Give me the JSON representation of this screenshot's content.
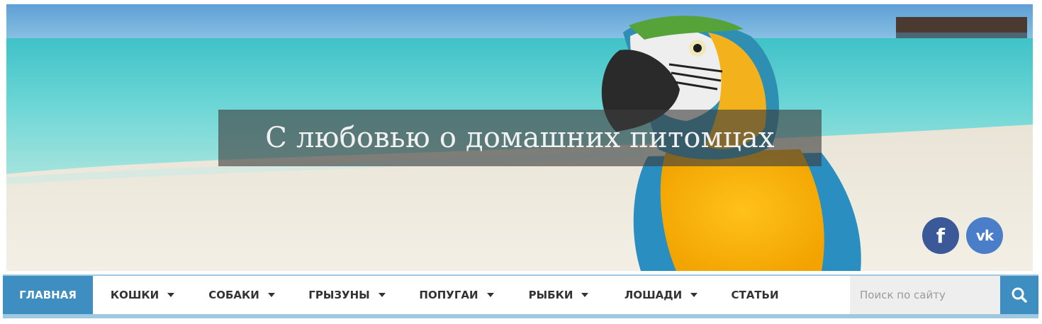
{
  "hero": {
    "title": "С любовью о домашних питомцах"
  },
  "social": {
    "facebook": {
      "label": "f",
      "color": "#3b5998"
    },
    "vk": {
      "label": "vk",
      "color": "#4a7ec9"
    }
  },
  "nav": {
    "items": [
      {
        "label": "ГЛАВНАЯ",
        "dropdown": false,
        "active": true
      },
      {
        "label": "КОШКИ",
        "dropdown": true
      },
      {
        "label": "СОБАКИ",
        "dropdown": true
      },
      {
        "label": "ГРЫЗУНЫ",
        "dropdown": true
      },
      {
        "label": "ПОПУГАИ",
        "dropdown": true
      },
      {
        "label": "РЫБКИ",
        "dropdown": true
      },
      {
        "label": "ЛОШАДИ",
        "dropdown": true
      },
      {
        "label": "СТАТЬИ",
        "dropdown": false
      }
    ],
    "accent": "#3e8ec1"
  },
  "search": {
    "placeholder": "Поиск по сайту",
    "icon": "search-icon"
  }
}
